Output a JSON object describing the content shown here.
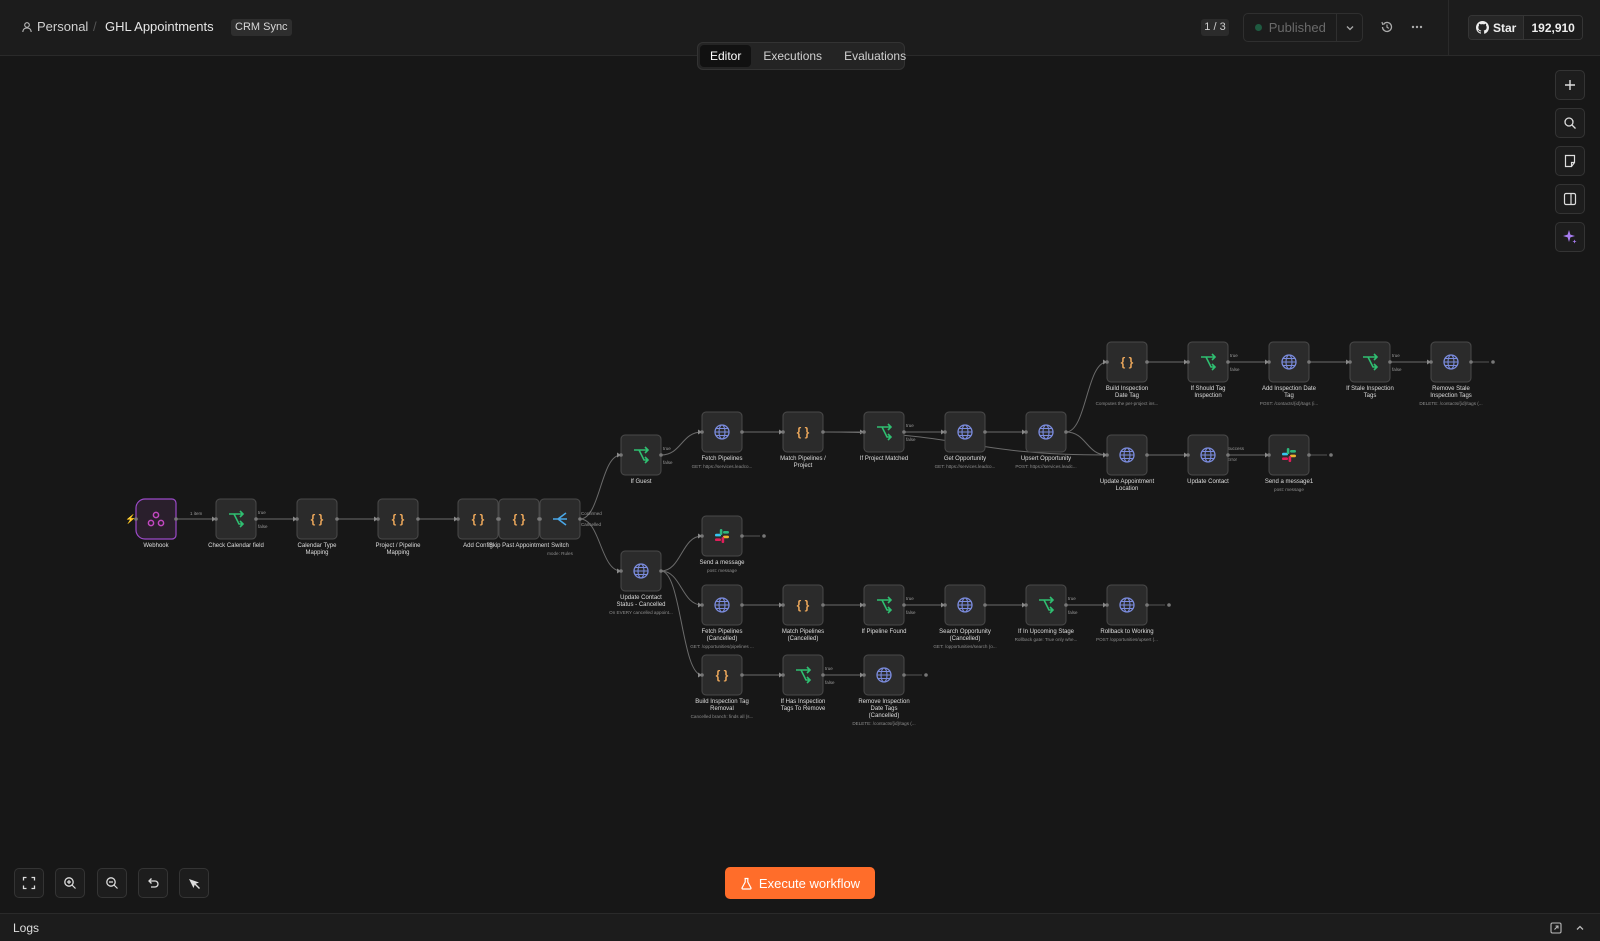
{
  "header": {
    "workspace": "Personal",
    "workflow_name": "GHL Appointments",
    "tag": "CRM Sync",
    "page_count": "1 / 3",
    "status": "Published",
    "github_star_label": "Star",
    "github_star_count": "192,910"
  },
  "tabs": [
    {
      "label": "Editor",
      "active": true
    },
    {
      "label": "Executions",
      "active": false
    },
    {
      "label": "Evaluations",
      "active": false
    }
  ],
  "canvas": {
    "nodes": [
      {
        "id": "webhook",
        "name": "Webhook",
        "sub": "",
        "icon": "webhook-icon",
        "kind": "trigger"
      },
      {
        "id": "check_calendar",
        "name": "Check Calendar field",
        "sub": "",
        "icon": "if-icon",
        "kind": "if"
      },
      {
        "id": "calendar_type",
        "name": "Calendar Type Mapping",
        "sub": "",
        "icon": "code-icon",
        "kind": "code"
      },
      {
        "id": "project_pipeline",
        "name": "Project / Pipeline Mapping",
        "sub": "",
        "icon": "code-icon",
        "kind": "code"
      },
      {
        "id": "add_config",
        "name": "Add Config",
        "sub": "",
        "icon": "code-icon",
        "kind": "code"
      },
      {
        "id": "skip_past",
        "name": "Skip Past Appointment",
        "sub": "",
        "icon": "code-icon",
        "kind": "code"
      },
      {
        "id": "switch",
        "name": "Switch",
        "sub": "mode: Rules",
        "icon": "switch-icon",
        "kind": "switch"
      },
      {
        "id": "if_guest",
        "name": "If Guest",
        "sub": "",
        "icon": "if-icon",
        "kind": "if"
      },
      {
        "id": "fetch_pipelines",
        "name": "Fetch Pipelines",
        "sub": "GET: https://services.leadco...",
        "icon": "http-icon",
        "kind": "http"
      },
      {
        "id": "match_pipelines",
        "name": "Match Pipelines / Project",
        "sub": "",
        "icon": "code-icon",
        "kind": "code"
      },
      {
        "id": "if_project_matched",
        "name": "If Project Matched",
        "sub": "",
        "icon": "if-icon",
        "kind": "if"
      },
      {
        "id": "get_opportunity",
        "name": "Get Opportunity",
        "sub": "GET: https://services.leadco...",
        "icon": "http-icon",
        "kind": "http"
      },
      {
        "id": "upsert_opportunity",
        "name": "Upsert Opportunity",
        "sub": "POST: https://services.leadc...",
        "icon": "http-icon",
        "kind": "http"
      },
      {
        "id": "build_inspection_tag",
        "name": "Build Inspection Date Tag",
        "sub": "Computes the per-project ins...",
        "icon": "code-icon",
        "kind": "code"
      },
      {
        "id": "if_should_tag",
        "name": "If Should Tag Inspection",
        "sub": "",
        "icon": "if-icon",
        "kind": "if"
      },
      {
        "id": "add_inspection_tag",
        "name": "Add Inspection Date Tag",
        "sub": "POST: /contacts/{id}/tags (i...",
        "icon": "http-icon",
        "kind": "http"
      },
      {
        "id": "if_stale",
        "name": "If Stale Inspection Tags",
        "sub": "",
        "icon": "if-icon",
        "kind": "if"
      },
      {
        "id": "remove_stale",
        "name": "Remove Stale Inspection Tags",
        "sub": "DELETE: /contacts/{id}/tags (...",
        "icon": "http-icon",
        "kind": "http"
      },
      {
        "id": "update_appt_location",
        "name": "Update Appointment Location",
        "sub": "",
        "icon": "http-icon",
        "kind": "http"
      },
      {
        "id": "update_contact",
        "name": "Update Contact",
        "sub": "",
        "icon": "http-icon",
        "kind": "http"
      },
      {
        "id": "send_message_1",
        "name": "Send a message1",
        "sub": "post: message",
        "icon": "slack-icon",
        "kind": "slack"
      },
      {
        "id": "send_message",
        "name": "Send a message",
        "sub": "post: message",
        "icon": "slack-icon",
        "kind": "slack"
      },
      {
        "id": "update_contact_cancelled",
        "name": "Update Contact Status - Cancelled",
        "sub": "On EVERY cancelled appoint...",
        "icon": "http-icon",
        "kind": "http"
      },
      {
        "id": "fetch_pipelines_c",
        "name": "Fetch Pipelines (Cancelled)",
        "sub": "GET: /opportunities/pipelines ...",
        "icon": "http-icon",
        "kind": "http"
      },
      {
        "id": "match_pipelines_c",
        "name": "Match Pipelines (Cancelled)",
        "sub": "",
        "icon": "code-icon",
        "kind": "code"
      },
      {
        "id": "if_pipeline_found",
        "name": "If Pipeline Found",
        "sub": "",
        "icon": "if-icon",
        "kind": "if"
      },
      {
        "id": "search_opportunity_c",
        "name": "Search Opportunity (Cancelled)",
        "sub": "GET: /opportunities/search (o...",
        "icon": "http-icon",
        "kind": "http"
      },
      {
        "id": "if_upcoming",
        "name": "If In Upcoming Stage",
        "sub": "Rollback gate: True only whe...",
        "icon": "if-icon",
        "kind": "if"
      },
      {
        "id": "rollback",
        "name": "Rollback to Working",
        "sub": "POST /opportunities/upsert (...",
        "icon": "http-icon",
        "kind": "http"
      },
      {
        "id": "build_tag_removal",
        "name": "Build Inspection Tag Removal",
        "sub": "Cancelled branch: finds all (s...",
        "icon": "code-icon",
        "kind": "code"
      },
      {
        "id": "if_has_tags",
        "name": "If Has Inspection Tags To Remove",
        "sub": "",
        "icon": "if-icon",
        "kind": "if"
      },
      {
        "id": "remove_tags_c",
        "name": "Remove Inspection Date Tags (Cancelled)",
        "sub": "DELETE: /contacts/{id}/tags (...",
        "icon": "http-icon",
        "kind": "http"
      }
    ],
    "edge_labels": {
      "items": "1 item",
      "true": "true",
      "false": "false",
      "confirmed": "Confirmed",
      "cancelled": "Cancelled",
      "success": "Success",
      "error": "Error"
    }
  },
  "footer": {
    "execute_label": "Execute workflow",
    "logs_label": "Logs"
  },
  "colors": {
    "accent": "#ff6d2a",
    "code": "#e8a55a",
    "if": "#2fbf71",
    "http": "#7b8cde",
    "switch": "#4aa8e8",
    "trigger": "#c248c0"
  }
}
